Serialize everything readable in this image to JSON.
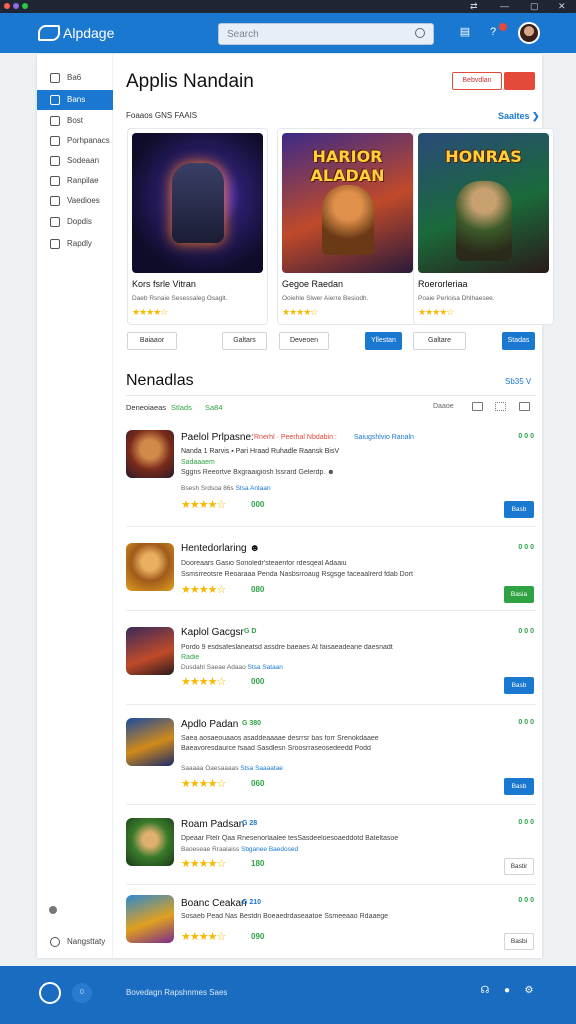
{
  "window": {
    "controls": [
      "⇄",
      "—",
      "▢",
      "✕"
    ]
  },
  "header": {
    "app_name": "Alpdage",
    "search_placeholder": "Search",
    "notification_count": "2"
  },
  "sidebar": {
    "items": [
      {
        "label": "Ba6",
        "active": false
      },
      {
        "label": "Bans",
        "active": true
      },
      {
        "label": "Bost",
        "active": false
      },
      {
        "label": "Porhpanacs",
        "active": false
      },
      {
        "label": "Sodeaan",
        "active": false
      },
      {
        "label": "Ranpilae",
        "active": false
      },
      {
        "label": "Vaedioes",
        "active": false
      },
      {
        "label": "Dopdis",
        "active": false
      },
      {
        "label": "Rapdly",
        "active": false
      }
    ],
    "bottom_label": "Nangsttaty"
  },
  "page": {
    "title": "Applis Nandain",
    "btn1": "Bebvdlan",
    "btn2": "",
    "featured_label": "Foaaos GNS FAAIS",
    "see_all": "Saaites ❯"
  },
  "featured": [
    {
      "name": "Kors fsrle Vitran",
      "desc": "Daeb Rsnaie Sesessaleg Osaglt.",
      "rating": "★★★★☆",
      "art": "",
      "btn_left": "Baiaaor",
      "btn_right": "Galtars",
      "btn_right_style": "plain"
    },
    {
      "name": "Gegoe Raedan",
      "desc": "Ooiehle Slwer Aierre Besiodh.",
      "rating": "★★★★☆",
      "art": "HARIOR ALADAN",
      "btn_left": "Deveoen",
      "btn_right": "Yllestan",
      "btn_right_style": "blue"
    },
    {
      "name": "Roerorleriaa",
      "desc": "Poaie Perloisa Dhlhaesee.",
      "rating": "★★★★☆",
      "art": "HONRAS",
      "btn_left": "Galtare",
      "btn_right": "Stadas",
      "btn_right_style": "blue"
    }
  ],
  "new_section": {
    "title": "Nenadlas",
    "right_label": "Sb35 V",
    "filter_label": "Deneoiaeas",
    "filter1": "Stlads",
    "filter2": "Sa84",
    "sort_label": "Daaoe"
  },
  "rows": [
    {
      "title": "Paelol Prlpasne:",
      "tag1": "Rnerhl · Peerhal Nbdabin : ",
      "tag2": "Saiugshlvio Ranaln",
      "sub": "Nanda 1 Rarvis  ▪  Pari Hraad Ruhadle Raansk BisV",
      "sub2": "Sadaaaem",
      "desc": "Sggns Reeortve Bxgraaigiosh lssrard Gelerdp. ☻",
      "meta": "Bsesh Srdsoa 86s  ",
      "meta_link": "Stsa Antaan",
      "rating": "★★★★☆",
      "count": "000",
      "price": "0 0 0",
      "button": "Basb",
      "button_style": "blue"
    },
    {
      "title": "Hentedorlaring ☻",
      "tag1": "",
      "tag2": "",
      "sub": "",
      "sub2": "",
      "desc": "Dooreaars Gasio Sorioledr'steaenfor rdesqeal Adaaiu",
      "desc2": "Ssmsrreotsre Reoaraaa Penda Nasbsrroaug Rsgsge faceaalrerd fdab Dort",
      "meta": "",
      "meta_link": "",
      "rating": "★★★★☆",
      "count": "080",
      "price": "0 0 0",
      "button": "Basia",
      "button_style": "green"
    },
    {
      "title": "Kaplol Gacgsr",
      "tag1": "G D",
      "tag2": "",
      "sub": "",
      "sub2": "",
      "desc": "Pordo 9 esdsafeslaneatsd assdre baeaes At faisaeadearie daesnadt",
      "desc2": "Radie",
      "meta": "Dusdahl Saeae Adaao  ",
      "meta_link": "Stsa Sataan",
      "rating": "★★★★☆",
      "count": "000",
      "price": "0 0 0",
      "button": "Basb",
      "button_style": "blue"
    },
    {
      "title": "Apdlo Padan",
      "tag1": "G 380",
      "tag2": "",
      "sub": "",
      "sub2": "",
      "desc": "Saea aosaeouaaos asaddeaaaae desrrsr bas forr Srenokdaaee",
      "desc2": "Baeavoresdaurce fsaad Sasdlesn Sroosrraseosedeedd  Podd",
      "meta": "Saaaaa Oaesaaaas  ",
      "meta_link": "Stsa Saaaatae",
      "rating": "★★★★☆",
      "count": "060",
      "price": "0 0 0",
      "button": "Basb",
      "button_style": "blue"
    },
    {
      "title": "Roam Padsan",
      "tag1": "G 28",
      "tag2": "",
      "sub": "",
      "sub2": "",
      "desc": "Dpeaar Ftelr Qaa Rnesenorlaalee tesSasdeeloesoaeddotd Bateltasoe",
      "desc2": "",
      "meta": "Baoeseae Rraalaiss  ",
      "meta_link": "Sbganee Baedosed",
      "rating": "★★★★☆",
      "count": "180",
      "price": "0 0 0",
      "button": "Bastir",
      "button_style": "plain"
    },
    {
      "title": "Boanc Ceakan",
      "tag1": "G 210",
      "tag2": "",
      "sub": "",
      "sub2": "",
      "desc": "Sosaeb Pead Nas Bestdn Boeaedrdaseaatoe Ssmeeaao Rdaaege",
      "desc2": "",
      "meta": "",
      "meta_link": "",
      "rating": "★★★★☆",
      "count": "090",
      "price": "0 0 0",
      "button": "Basbi",
      "button_style": "plain"
    }
  ],
  "footer": {
    "dot_label": "0",
    "links": "Bovedagn   Rapshnmes Saes"
  },
  "colors": {
    "primary": "#1a78d0",
    "green": "#2fa344",
    "star": "#f6b800",
    "footer": "#1a6cc0"
  }
}
